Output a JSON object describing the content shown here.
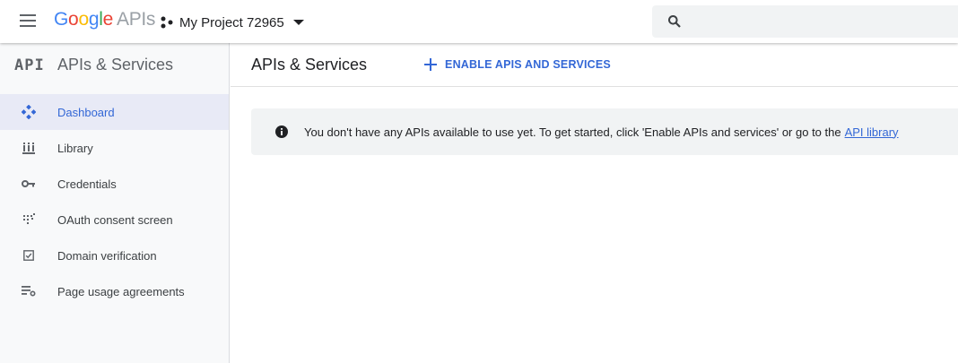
{
  "header": {
    "logo_google": [
      "G",
      "o",
      "o",
      "g",
      "l",
      "e"
    ],
    "logo_apis": "APIs",
    "project_name": "My Project 72965"
  },
  "sidebar": {
    "logo_text": "API",
    "title": "APIs & Services",
    "items": [
      {
        "label": "Dashboard",
        "icon": "dashboard-icon",
        "active": true
      },
      {
        "label": "Library",
        "icon": "library-icon",
        "active": false
      },
      {
        "label": "Credentials",
        "icon": "key-icon",
        "active": false
      },
      {
        "label": "OAuth consent screen",
        "icon": "oauth-consent-icon",
        "active": false
      },
      {
        "label": "Domain verification",
        "icon": "domain-verification-icon",
        "active": false
      },
      {
        "label": "Page usage agreements",
        "icon": "page-usage-icon",
        "active": false
      }
    ]
  },
  "main": {
    "title": "APIs & Services",
    "enable_label": "ENABLE APIS AND SERVICES",
    "banner_text": "You don't have any APIs available to use yet. To get started, click 'Enable APIs and services' or go to the",
    "banner_link": "API library"
  },
  "colors": {
    "accent": "#3367d6",
    "active_bg": "#e8eaf6",
    "sidebar_bg": "#f8f9fa",
    "banner_bg": "#f1f3f4"
  }
}
